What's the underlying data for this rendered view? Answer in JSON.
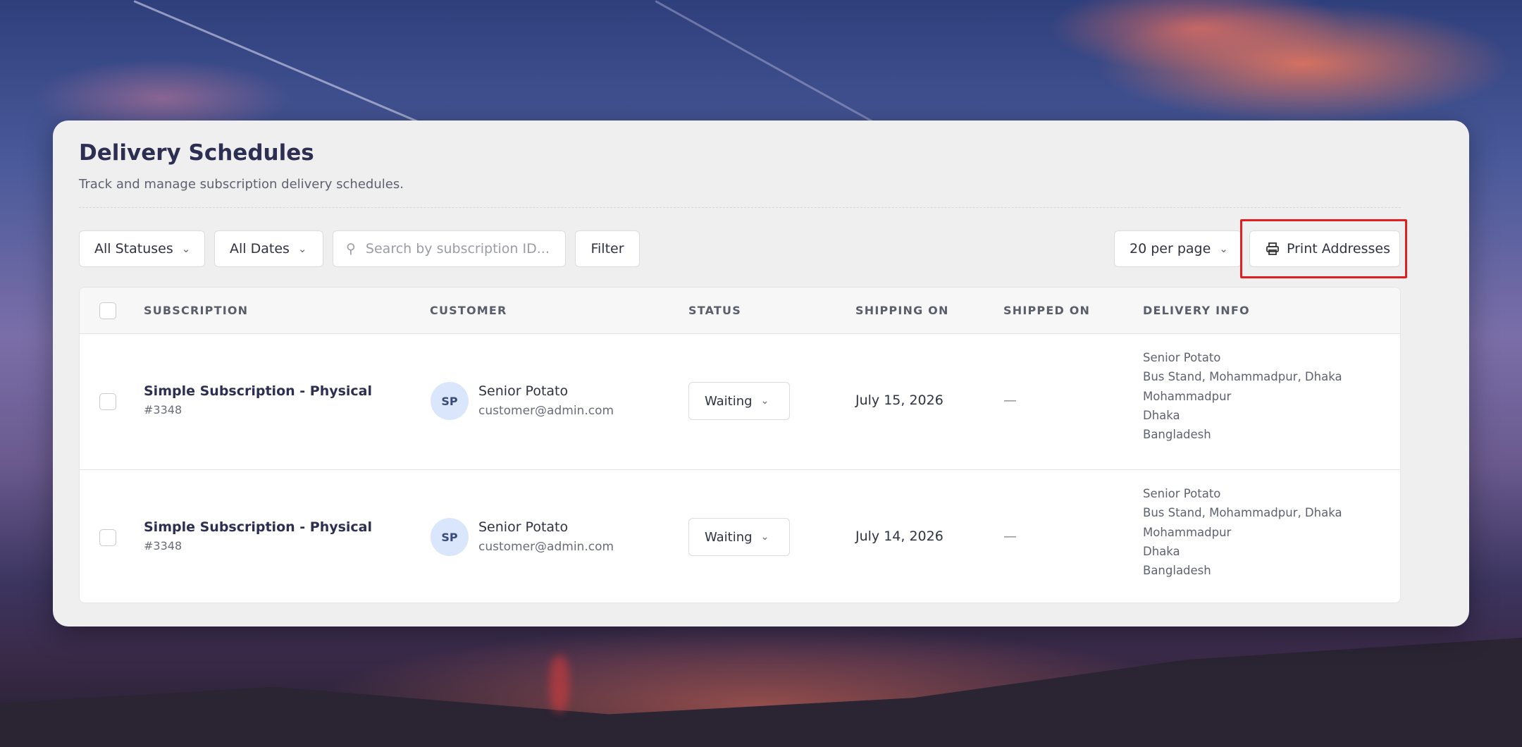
{
  "page": {
    "title": "Delivery Schedules",
    "subtitle": "Track and manage subscription delivery schedules."
  },
  "filters": {
    "status_select": "All Statuses",
    "date_select": "All Dates",
    "search_placeholder": "Search by subscription ID...",
    "filter_button": "Filter",
    "per_page_select": "20 per page",
    "print_button": "Print Addresses"
  },
  "table": {
    "headers": [
      "SUBSCRIPTION",
      "CUSTOMER",
      "STATUS",
      "SHIPPING ON",
      "SHIPPED ON",
      "DELIVERY INFO"
    ],
    "rows": [
      {
        "subscription_name": "Simple Subscription - Physical",
        "subscription_id": "#3348",
        "avatar_initials": "SP",
        "customer_name": "Senior Potato",
        "customer_email": "customer@admin.com",
        "status": "Waiting",
        "shipping_on": "July 15, 2026",
        "shipped_on": "—",
        "delivery_info": [
          "Senior Potato",
          "Bus Stand, Mohammadpur, Dhaka",
          "Mohammadpur",
          "Dhaka",
          "Bangladesh"
        ]
      },
      {
        "subscription_name": "Simple Subscription - Physical",
        "subscription_id": "#3348",
        "avatar_initials": "SP",
        "customer_name": "Senior Potato",
        "customer_email": "customer@admin.com",
        "status": "Waiting",
        "shipping_on": "July 14, 2026",
        "shipped_on": "—",
        "delivery_info": [
          "Senior Potato",
          "Bus Stand, Mohammadpur, Dhaka",
          "Mohammadpur",
          "Dhaka",
          "Bangladesh"
        ]
      }
    ]
  },
  "icons": {
    "chevron": "chevron-down-icon",
    "search": "search-icon",
    "printer": "printer-icon"
  },
  "colors": {
    "highlight": "#e02020",
    "heading": "#2c2f52",
    "avatar_bg": "#d9e6fb"
  }
}
